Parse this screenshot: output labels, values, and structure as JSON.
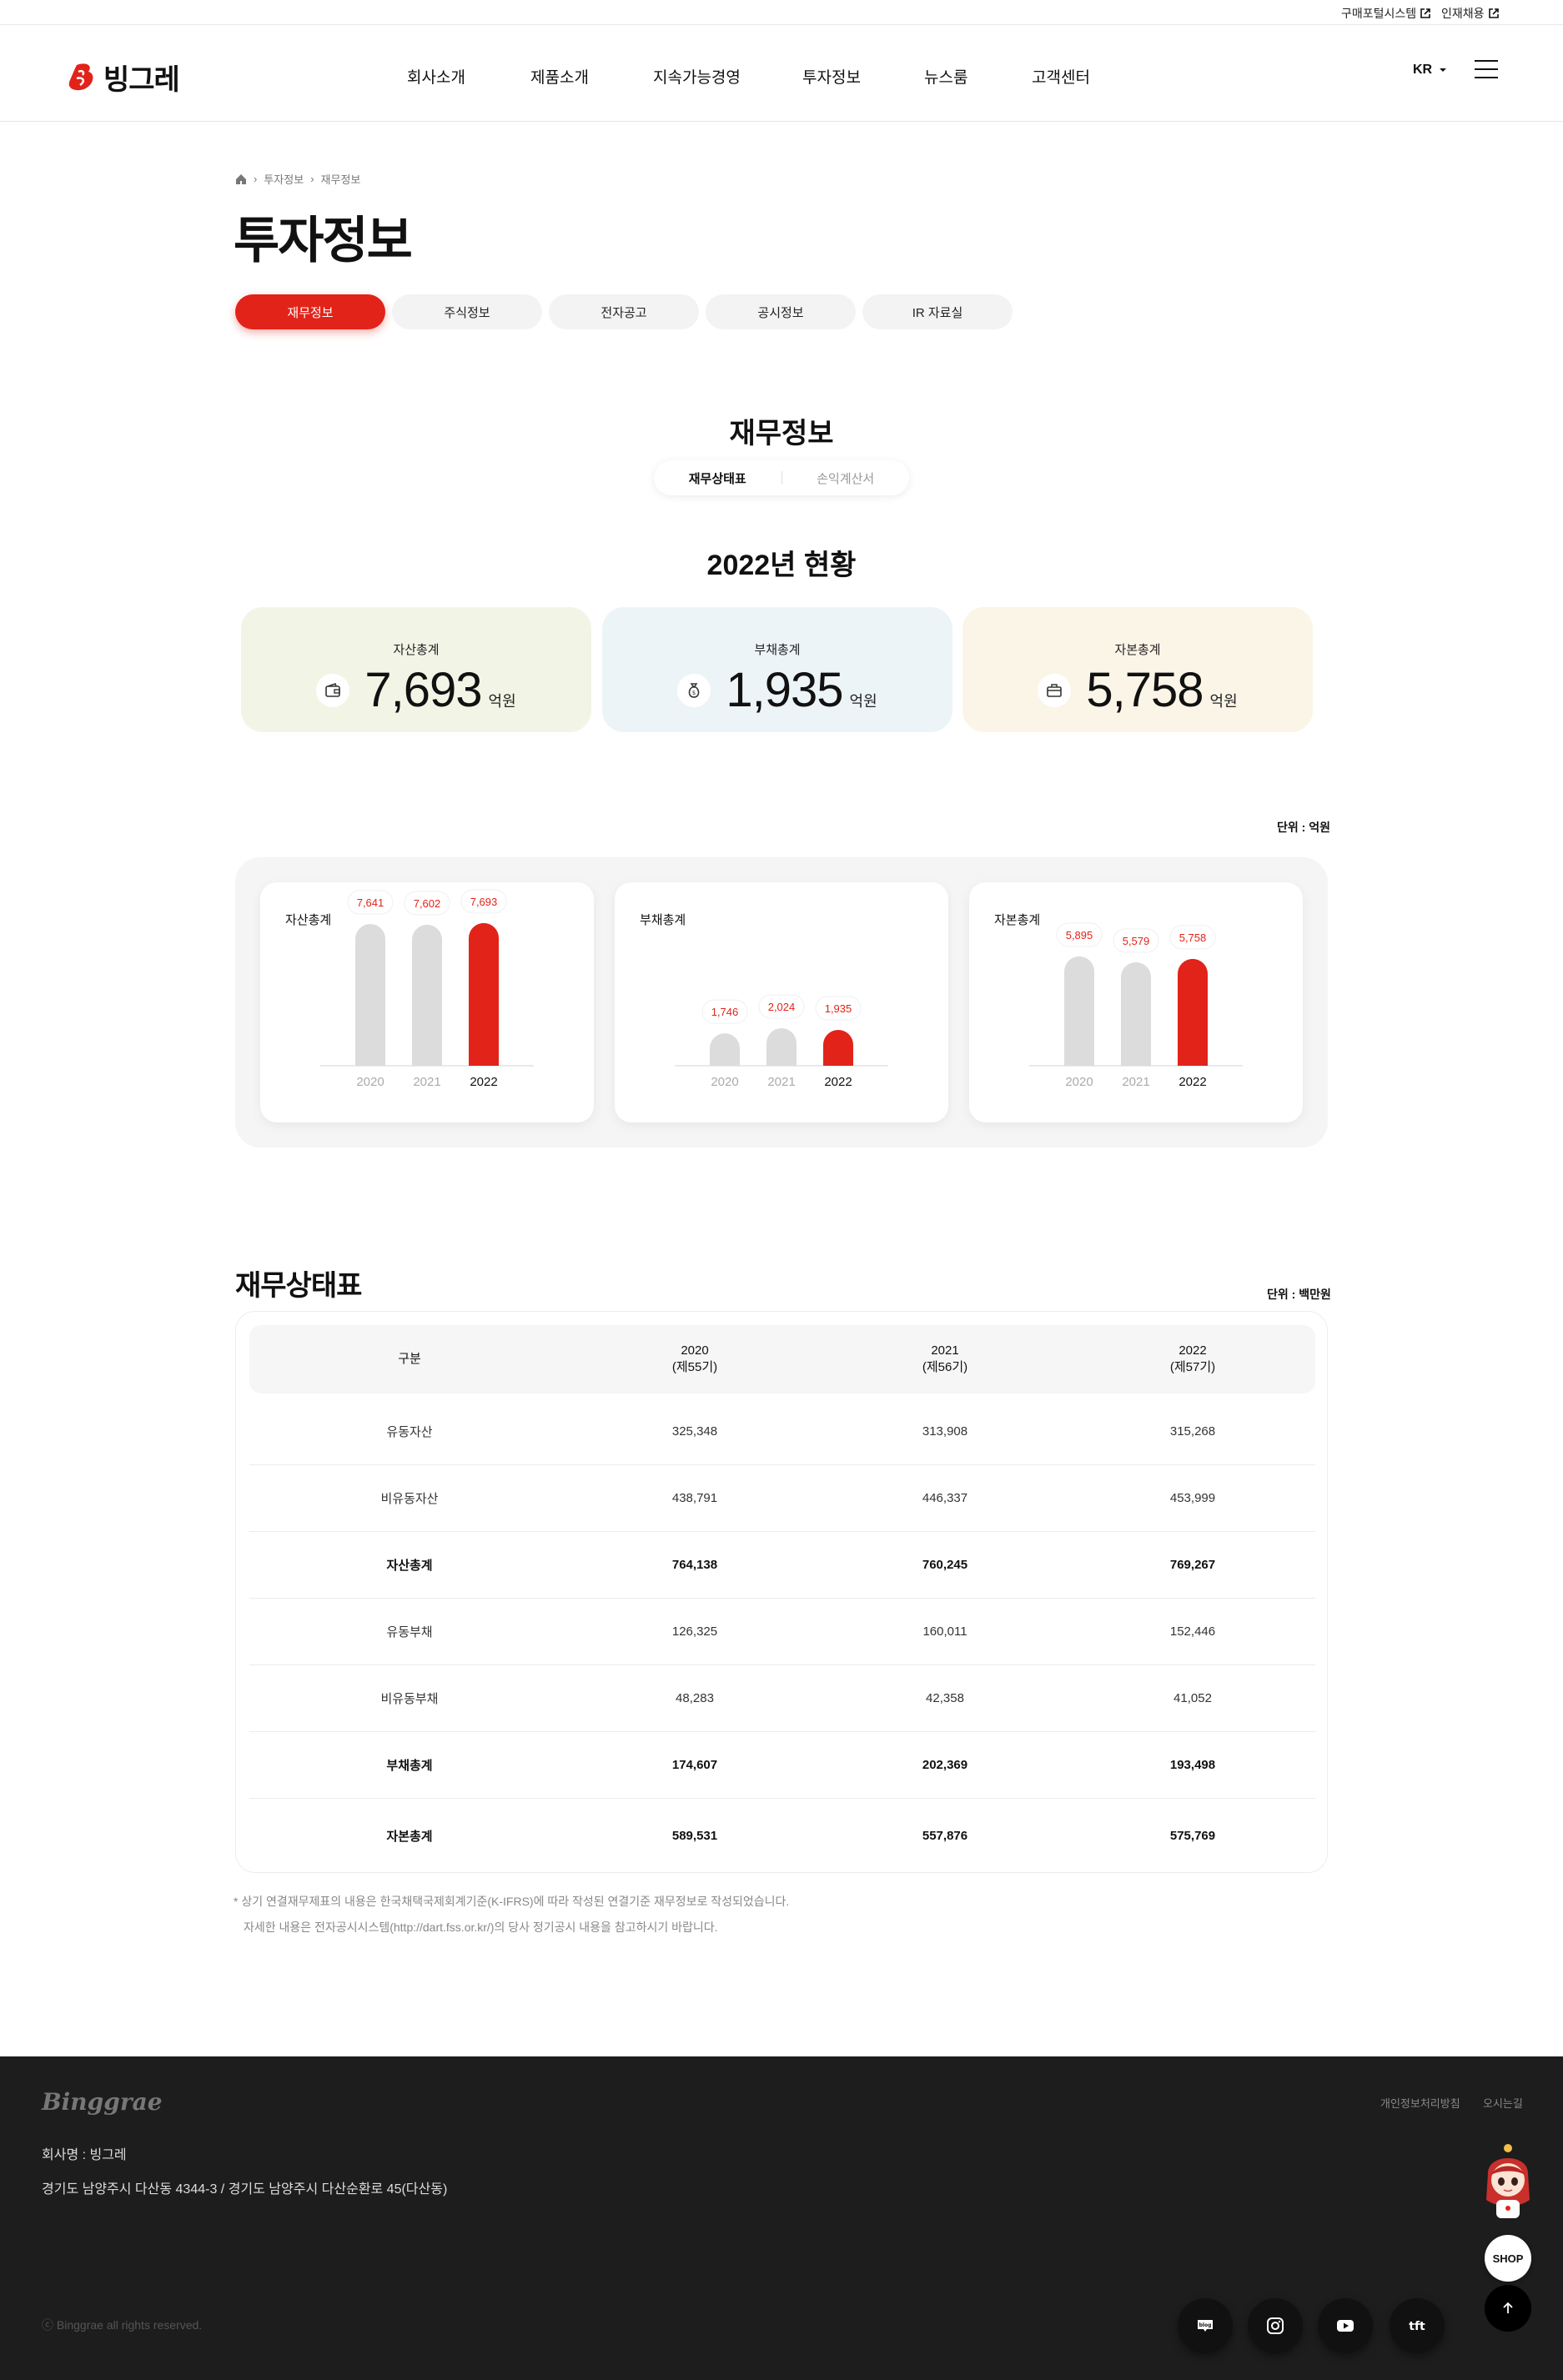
{
  "topbar": {
    "links": [
      "구매포털시스템",
      "인재채용"
    ]
  },
  "header": {
    "logo_text": "빙그레",
    "nav": [
      "회사소개",
      "제품소개",
      "지속가능경영",
      "투자정보",
      "뉴스룸",
      "고객센터"
    ],
    "lang": "KR"
  },
  "breadcrumb": [
    "투자정보",
    "재무정보"
  ],
  "page_title": "투자정보",
  "tabs": [
    "재무정보",
    "주식정보",
    "전자공고",
    "공시정보",
    "IR 자료실"
  ],
  "section_title": "재무정보",
  "subtabs": [
    "재무상태표",
    "손익계산서"
  ],
  "year_title": "2022년 현황",
  "summary": [
    {
      "label": "자산총계",
      "value": "7,693",
      "unit": "억원",
      "icon": "wallet-icon",
      "bg": "#f2f5e6"
    },
    {
      "label": "부채총계",
      "value": "1,935",
      "unit": "억원",
      "icon": "money-bag-icon",
      "bg": "#edf4f8"
    },
    {
      "label": "자본총계",
      "value": "5,758",
      "unit": "억원",
      "icon": "briefcase-icon",
      "bg": "#fbf5e7"
    }
  ],
  "chart_unit": "단위 : 억원",
  "chart_data": [
    {
      "type": "bar",
      "title": "자산총계",
      "categories": [
        "2020",
        "2021",
        "2022"
      ],
      "values": [
        7641,
        7602,
        7693
      ],
      "labels": [
        "7,641",
        "7,602",
        "7,693"
      ]
    },
    {
      "type": "bar",
      "title": "부채총계",
      "categories": [
        "2020",
        "2021",
        "2022"
      ],
      "values": [
        1746,
        2024,
        1935
      ],
      "labels": [
        "1,746",
        "2,024",
        "1,935"
      ]
    },
    {
      "type": "bar",
      "title": "자본총계",
      "categories": [
        "2020",
        "2021",
        "2022"
      ],
      "values": [
        5895,
        5579,
        5758
      ],
      "labels": [
        "5,895",
        "5,579",
        "5,758"
      ]
    }
  ],
  "colors": {
    "accent": "#e2231a",
    "bar_past": "#dcdcdc",
    "footer_bg": "#1d1d1d"
  },
  "table": {
    "title": "재무상태표",
    "unit": "단위 : 백만원",
    "headers": [
      {
        "l1": "구분",
        "l2": ""
      },
      {
        "l1": "2020",
        "l2": "(제55기)"
      },
      {
        "l1": "2021",
        "l2": "(제56기)"
      },
      {
        "l1": "2022",
        "l2": "(제57기)"
      }
    ],
    "rows": [
      {
        "cells": [
          "유동자산",
          "325,348",
          "313,908",
          "315,268"
        ],
        "bold": false
      },
      {
        "cells": [
          "비유동자산",
          "438,791",
          "446,337",
          "453,999"
        ],
        "bold": false
      },
      {
        "cells": [
          "자산총계",
          "764,138",
          "760,245",
          "769,267"
        ],
        "bold": true
      },
      {
        "cells": [
          "유동부채",
          "126,325",
          "160,011",
          "152,446"
        ],
        "bold": false
      },
      {
        "cells": [
          "비유동부채",
          "48,283",
          "42,358",
          "41,052"
        ],
        "bold": false
      },
      {
        "cells": [
          "부채총계",
          "174,607",
          "202,369",
          "193,498"
        ],
        "bold": true
      },
      {
        "cells": [
          "자본총계",
          "589,531",
          "557,876",
          "575,769"
        ],
        "bold": true
      }
    ]
  },
  "footnotes": [
    "* 상기 연결재무제표의 내용은 한국채택국제회계기준(K-IFRS)에 따라 작성된 연결기준 재무정보로 작성되었습니다.",
    "자세한 내용은 전자공시시스템(http://dart.fss.or.kr/)의 당사 정기공시 내용을 참고하시기 바랍니다."
  ],
  "footer": {
    "logo": "Binggrae",
    "links": [
      "개인정보처리방침",
      "오시는길"
    ],
    "company": "회사명 : 빙그레",
    "address": "경기도 남양주시 다산동 4344-3 / 경기도 남양주시 다산순환로 45(다산동)",
    "copyright": "ⓒ Binggrae all rights reserved.",
    "sns": [
      "blog-icon",
      "instagram-icon",
      "youtube-icon",
      "tft-icon"
    ],
    "shop_label": "SHOP"
  }
}
